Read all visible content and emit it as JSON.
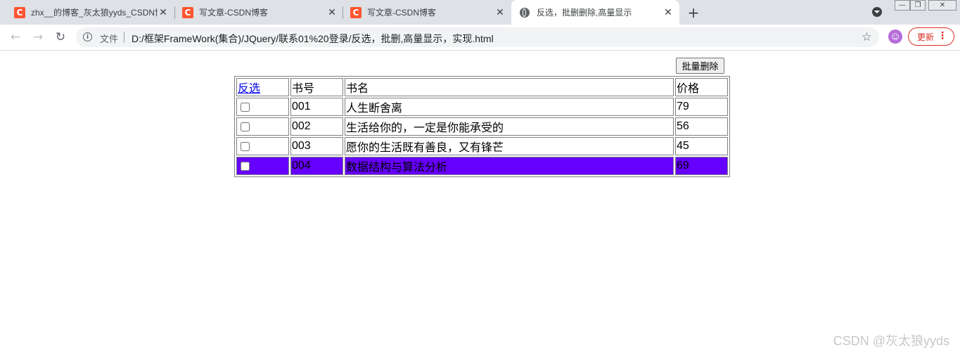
{
  "browser": {
    "tabs": [
      {
        "title": "zhx__的博客_灰太狼yyds_CSDN博客",
        "favicon": "C"
      },
      {
        "title": "写文章-CSDN博客",
        "favicon": "C"
      },
      {
        "title": "写文章-CSDN博客",
        "favicon": "C"
      },
      {
        "title": "反选，批删删除,高量显示",
        "favicon": "globe-icon"
      }
    ],
    "close_glyph": "✕",
    "new_tab_glyph": "+",
    "nav": {
      "back": "←",
      "forward": "→",
      "reload": "↻"
    },
    "address": {
      "chip": "文件",
      "url": "D:/框架FrameWork(集合)/JQuery/联系01%20登录/反选，批删,高量显示，实现.html"
    },
    "star_glyph": "☆",
    "avatar_glyph": "☺",
    "update_label": "更新",
    "menu_glyph": "⋮"
  },
  "page": {
    "batch_delete_label": "批量删除",
    "table": {
      "headers": [
        "反选",
        "书号",
        "书名",
        "价格"
      ],
      "rows": [
        {
          "id": "001",
          "name": "人生断舍离",
          "price": "79",
          "checked": false,
          "highlighted": false
        },
        {
          "id": "002",
          "name": "生活给你的，一定是你能承受的",
          "price": "56",
          "checked": false,
          "highlighted": false
        },
        {
          "id": "003",
          "name": "愿你的生活既有善良，又有锋芒",
          "price": "45",
          "checked": false,
          "highlighted": false
        },
        {
          "id": "004",
          "name": "数据结构与算法分析",
          "price": "69",
          "checked": false,
          "highlighted": true
        }
      ],
      "highlight_color": "#6600ff"
    }
  },
  "watermark": "CSDN @灰太狼yyds"
}
